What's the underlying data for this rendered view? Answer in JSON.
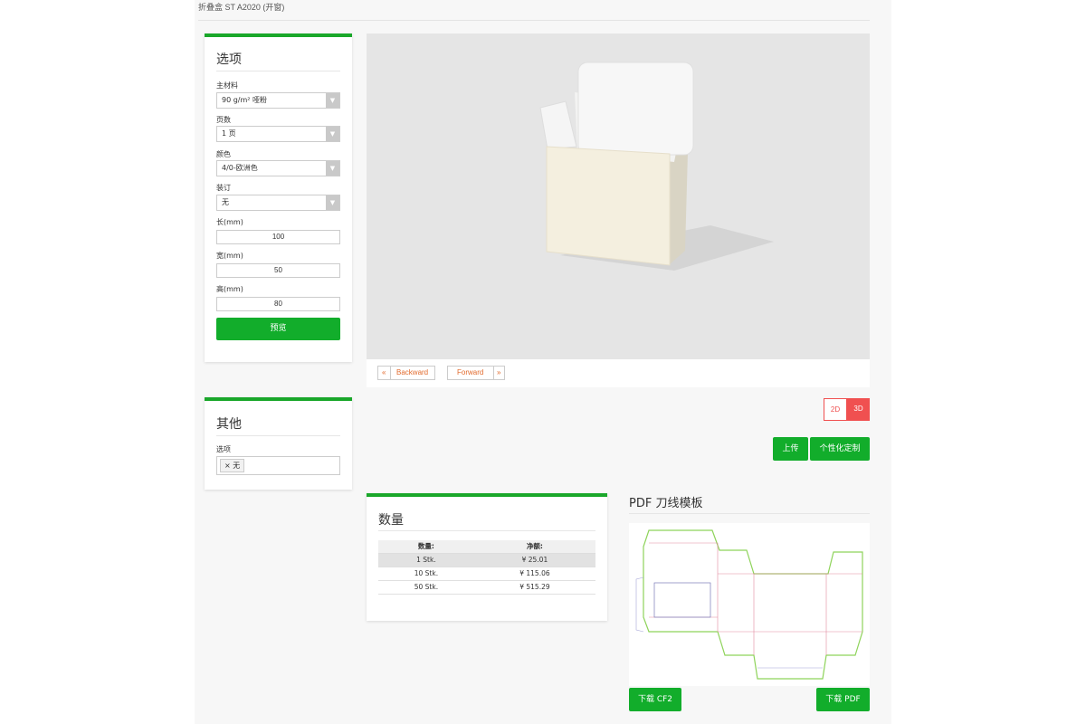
{
  "header": {
    "breadcrumb": "折叠盒 ST A2020 (开窗)"
  },
  "options": {
    "title": "选项",
    "material_label": "主材料",
    "material_value": "90 g/m² 哑粉",
    "pages_label": "页数",
    "pages_value": "1 页",
    "color_label": "颜色",
    "color_value": "4/0-欧洲色",
    "binding_label": "装订",
    "binding_value": "无",
    "length_label": "长(mm)",
    "length_value": "100",
    "width_label": "宽(mm)",
    "width_value": "50",
    "height_label": "高(mm)",
    "height_value": "80",
    "preview_button": "预览"
  },
  "other": {
    "title": "其他",
    "options_label": "选项",
    "tag_remove": "×",
    "tag_value": "无"
  },
  "viewer": {
    "backward_arrow": "«",
    "backward_label": "Backward",
    "forward_label": "Forward",
    "forward_arrow": "»",
    "toggle_2d": "2D",
    "toggle_3d": "3D",
    "upload_button": "上传",
    "customize_button": "个性化定制"
  },
  "quantity": {
    "title": "数量",
    "headers": [
      "数量:",
      "净额:"
    ],
    "rows": [
      {
        "qty": "1 Stk.",
        "price": "¥ 25.01"
      },
      {
        "qty": "10 Stk.",
        "price": "¥ 115.06"
      },
      {
        "qty": "50 Stk.",
        "price": "¥ 515.29"
      }
    ]
  },
  "pdf": {
    "title": "PDF 刀线模板",
    "download_cf2": "下载 CF2",
    "download_pdf": "下载 PDF"
  },
  "colors": {
    "accent_green": "#1aa72a",
    "button_green": "#12ad2b",
    "toggle_active": "#f05050",
    "nav_text": "#e26a2c"
  }
}
